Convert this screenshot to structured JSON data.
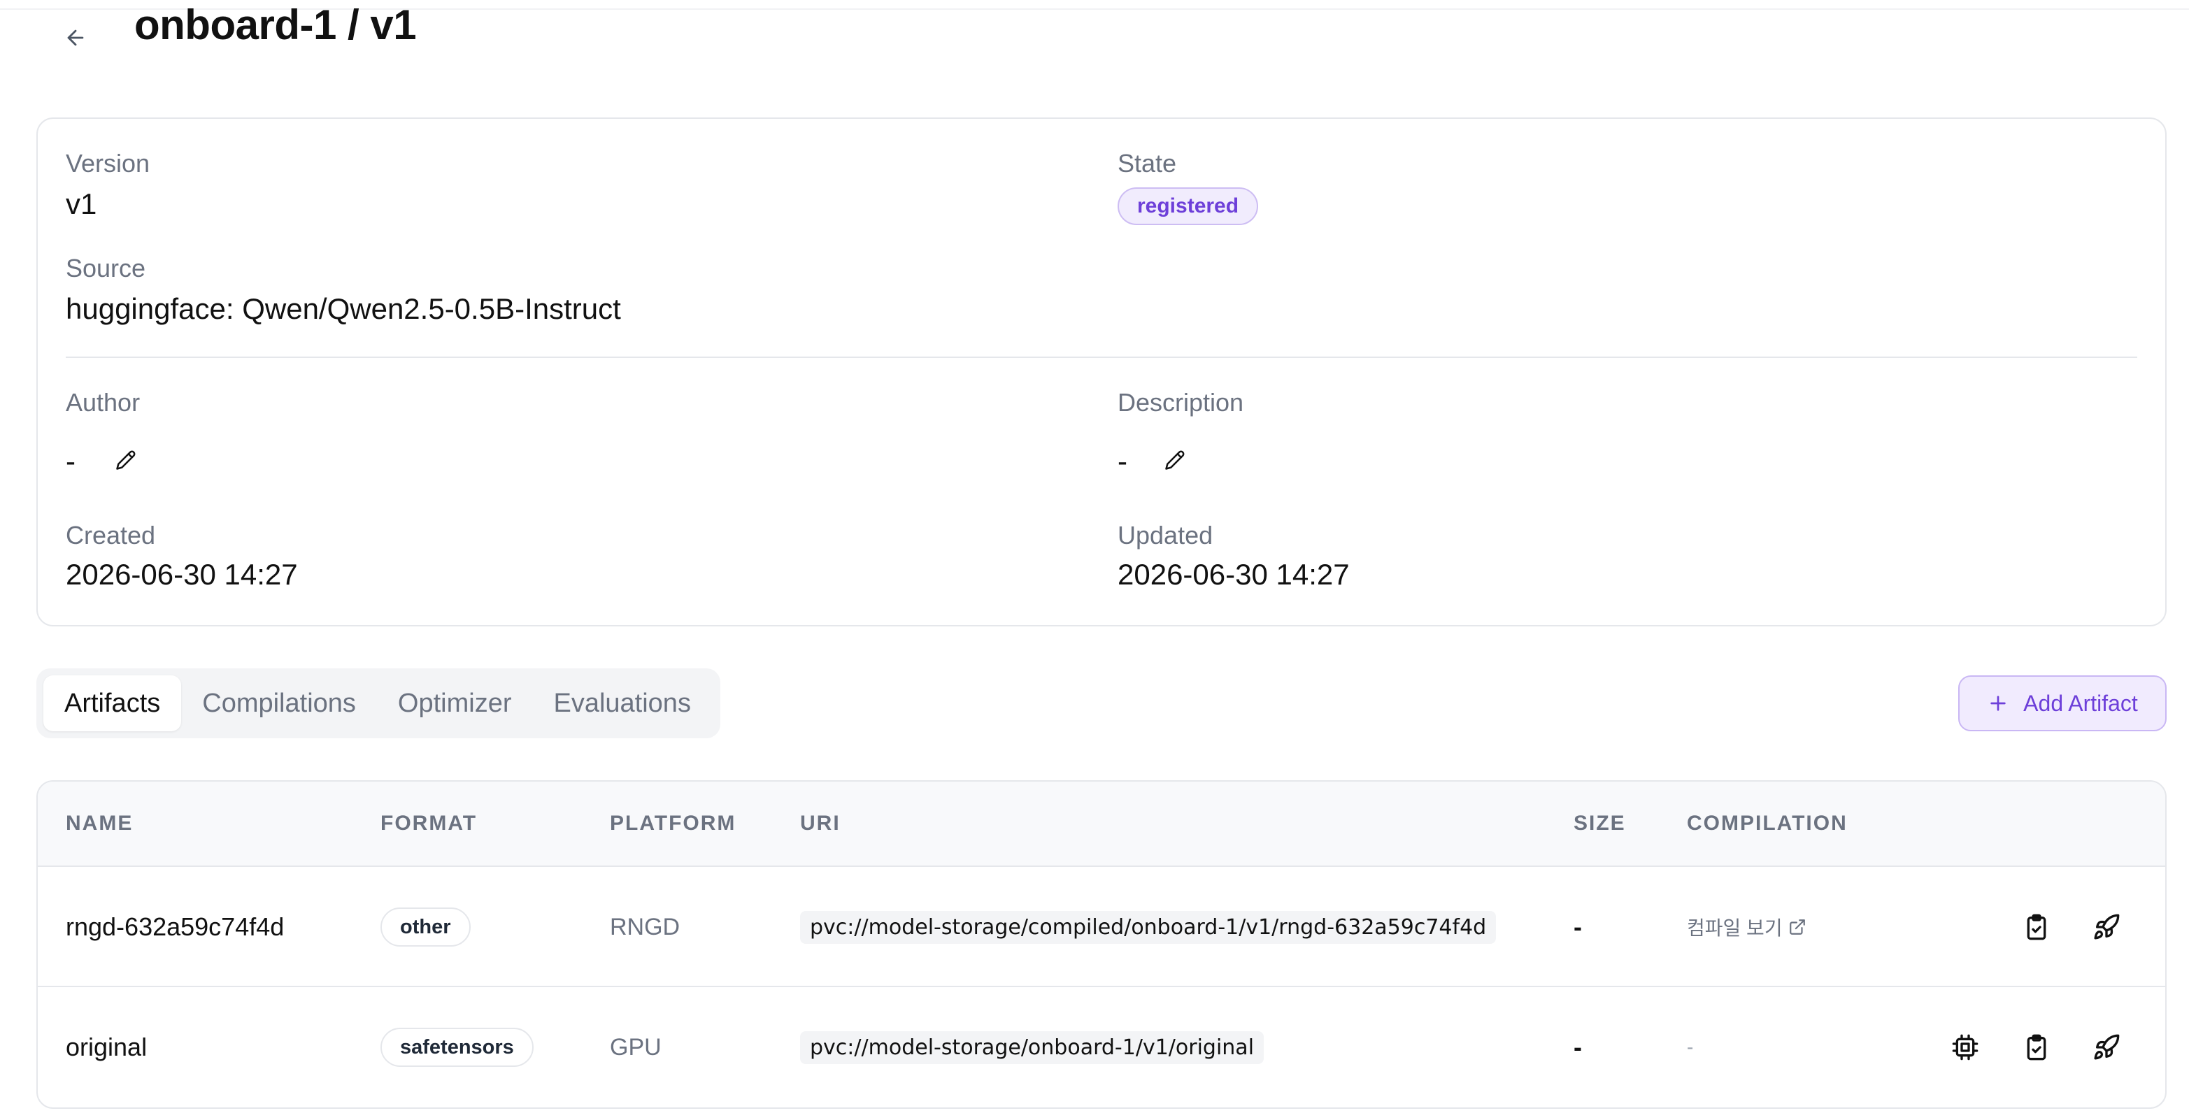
{
  "header": {
    "title": "onboard-1 / v1"
  },
  "details": {
    "version_label": "Version",
    "version_value": "v1",
    "state_label": "State",
    "state_value": "registered",
    "source_label": "Source",
    "source_value": "huggingface: Qwen/Qwen2.5-0.5B-Instruct",
    "author_label": "Author",
    "author_value": "-",
    "description_label": "Description",
    "description_value": "-",
    "created_label": "Created",
    "created_value": "2026-06-30 14:27",
    "updated_label": "Updated",
    "updated_value": "2026-06-30 14:27"
  },
  "tabs": [
    {
      "label": "Artifacts",
      "active": true
    },
    {
      "label": "Compilations",
      "active": false
    },
    {
      "label": "Optimizer",
      "active": false
    },
    {
      "label": "Evaluations",
      "active": false
    }
  ],
  "actions": {
    "add_artifact": "Add Artifact"
  },
  "table": {
    "columns": [
      "NAME",
      "FORMAT",
      "PLATFORM",
      "URI",
      "SIZE",
      "COMPILATION"
    ],
    "rows": [
      {
        "name": "rngd-632a59c74f4d",
        "format": "other",
        "platform": "RNGD",
        "uri": "pvc://model-storage/compiled/onboard-1/v1/rngd-632a59c74f4d",
        "size": "-",
        "compilation": "컴파일 보기"
      },
      {
        "name": "original",
        "format": "safetensors",
        "platform": "GPU",
        "uri": "pvc://model-storage/onboard-1/v1/original",
        "size": "-",
        "compilation": "-"
      }
    ]
  },
  "icons": {
    "back": "arrow-left-icon",
    "edit": "pencil-icon",
    "add": "plus-icon",
    "external": "external-link-icon",
    "compile": "cpu-chip-icon",
    "evaluate": "clipboard-check-icon",
    "deploy": "rocket-icon"
  },
  "colors": {
    "accent": "#6d3fd9",
    "accent_bg": "#f1ebfe",
    "border": "#e5e7eb",
    "muted_text": "#6b7280"
  }
}
